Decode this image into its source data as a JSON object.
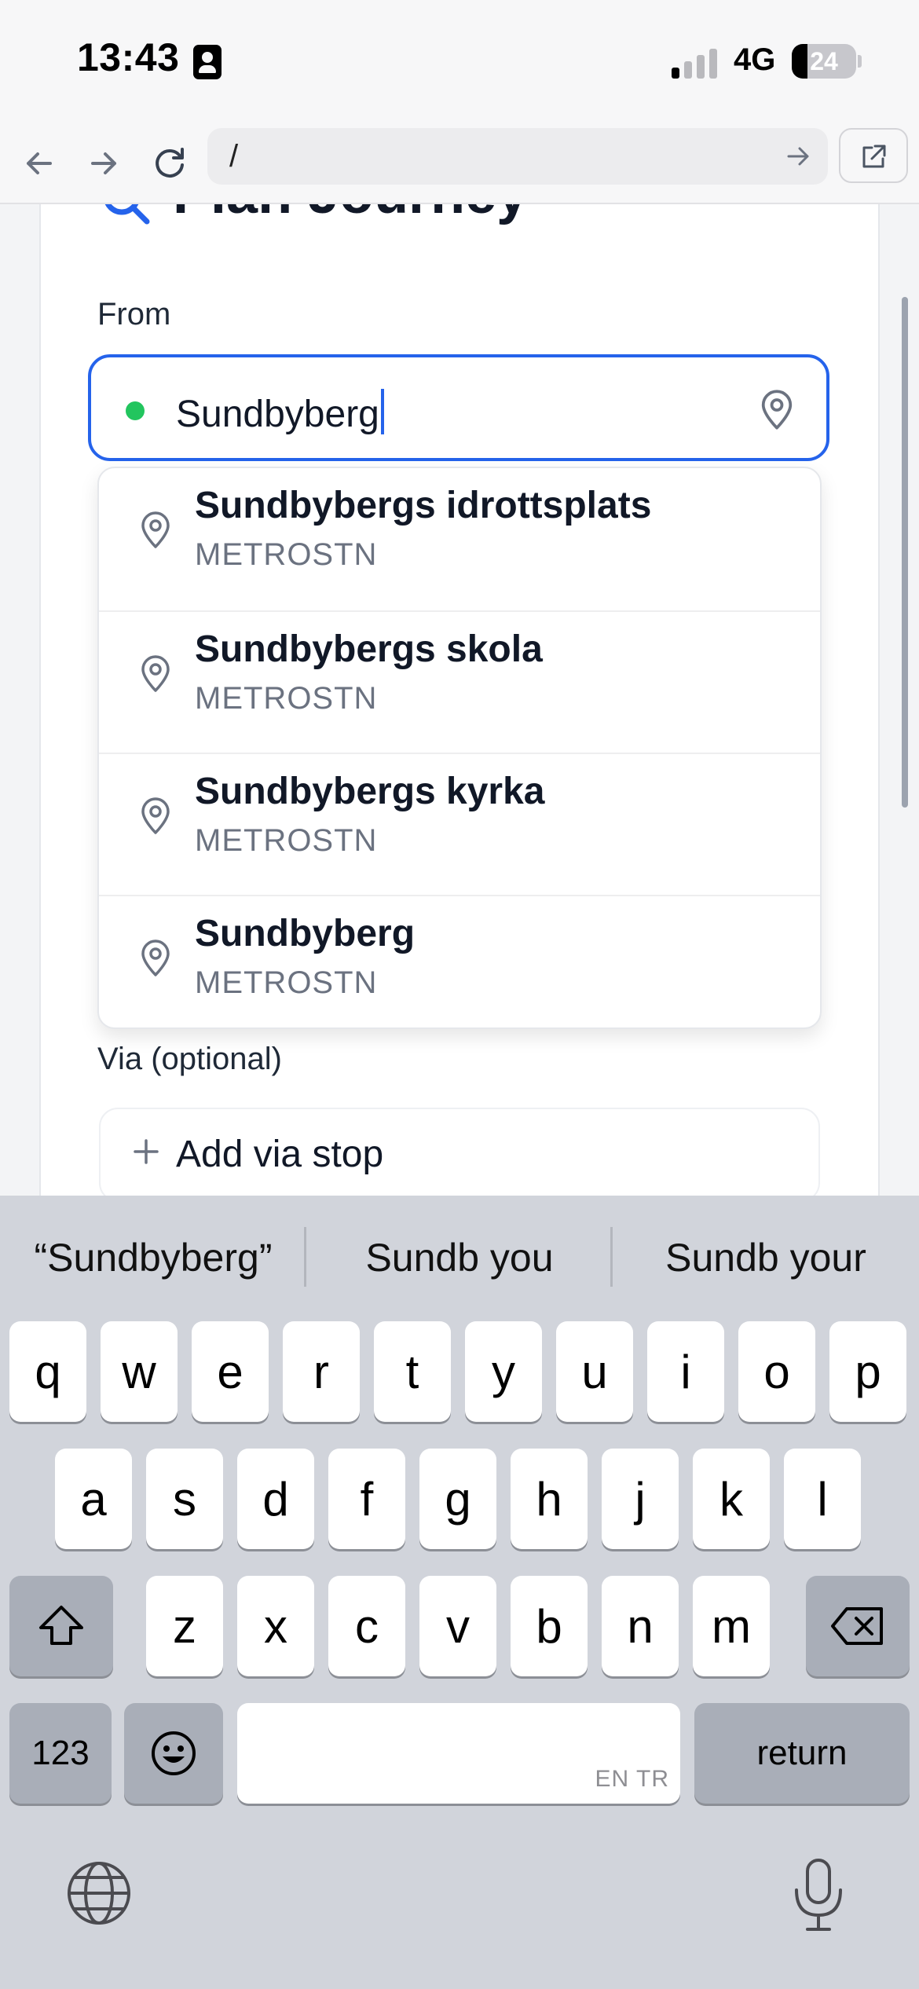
{
  "status_bar": {
    "time": "13:43",
    "network": "4G",
    "battery": "24",
    "battery_level": 0.24
  },
  "browser": {
    "url": "/"
  },
  "page": {
    "title": "Plan Journey",
    "from_label": "From",
    "from_value": "Sundbyberg",
    "suggestions": [
      {
        "name": "Sundbybergs idrottsplats",
        "type": "METROSTN"
      },
      {
        "name": "Sundbybergs skola",
        "type": "METROSTN"
      },
      {
        "name": "Sundbybergs kyrka",
        "type": "METROSTN"
      },
      {
        "name": "Sundbyberg",
        "type": "METROSTN"
      }
    ],
    "via_label": "Via (optional)",
    "via_button": "Add via stop"
  },
  "keyboard": {
    "predictions": [
      "“Sundbyberg”",
      "Sundb you",
      "Sundb your"
    ],
    "row1": [
      "q",
      "w",
      "e",
      "r",
      "t",
      "y",
      "u",
      "i",
      "o",
      "p"
    ],
    "row2": [
      "a",
      "s",
      "d",
      "f",
      "g",
      "h",
      "j",
      "k",
      "l"
    ],
    "row3": [
      "z",
      "x",
      "c",
      "v",
      "b",
      "n",
      "m"
    ],
    "numbers_key": "123",
    "space_hint": "EN TR",
    "return_key": "return"
  },
  "colors": {
    "accent": "#2563eb",
    "origin_dot": "#22c55e",
    "muted_text": "#6b7280"
  }
}
